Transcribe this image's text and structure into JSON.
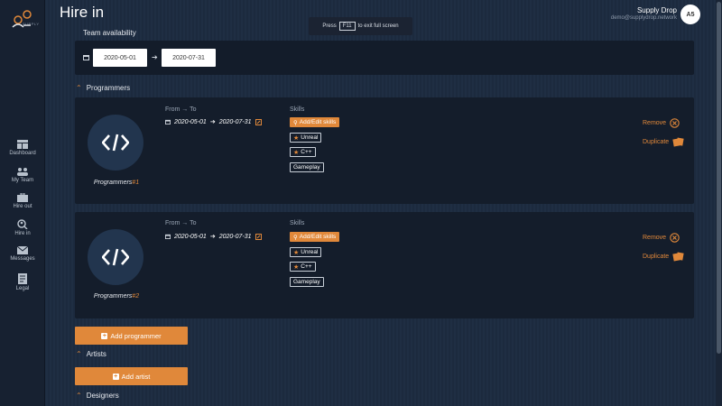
{
  "app": {
    "logo_text": "SUPPLY",
    "page_title": "Hire in",
    "fullscreen_hint": {
      "prefix": "Press",
      "key": "F11",
      "suffix": "to exit full screen"
    },
    "user": {
      "name": "Supply Drop",
      "email": "demo@supplydrop.network",
      "initials": "A5"
    }
  },
  "sidebar": {
    "items": [
      {
        "label": "Dashboard",
        "icon": "dashboard-icon"
      },
      {
        "label": "My Team",
        "icon": "team-icon"
      },
      {
        "label": "Hire out",
        "icon": "briefcase-icon"
      },
      {
        "label": "Hire in",
        "icon": "search-person-icon"
      },
      {
        "label": "Messages",
        "icon": "envelope-icon"
      },
      {
        "label": "Legal",
        "icon": "document-icon"
      }
    ]
  },
  "availability": {
    "label": "Team availability",
    "from": "2020-05-01",
    "to": "2020-07-31"
  },
  "sections": {
    "programmers": "Programmers",
    "artists": "Artists",
    "designers": "Designers"
  },
  "cards": [
    {
      "name": "Programmers",
      "number": "#1",
      "from_to_label": "From → To",
      "from": "2020-05-01",
      "to": "2020-07-31",
      "skills_label": "Skills",
      "edit_skills": "Add/Edit skills",
      "skills": [
        "Unreal",
        "C++",
        "Gameplay"
      ],
      "remove": "Remove",
      "duplicate": "Duplicate"
    },
    {
      "name": "Programmers",
      "number": "#2",
      "from_to_label": "From → To",
      "from": "2020-05-01",
      "to": "2020-07-31",
      "skills_label": "Skills",
      "edit_skills": "Add/Edit skills",
      "skills": [
        "Unreal",
        "C++",
        "Gameplay"
      ],
      "remove": "Remove",
      "duplicate": "Duplicate"
    }
  ],
  "buttons": {
    "add_programmer": "Add programmer",
    "add_artist": "Add artist"
  },
  "colors": {
    "accent": "#e0883a",
    "panel": "#141d2b",
    "background": "#1d2c40"
  }
}
